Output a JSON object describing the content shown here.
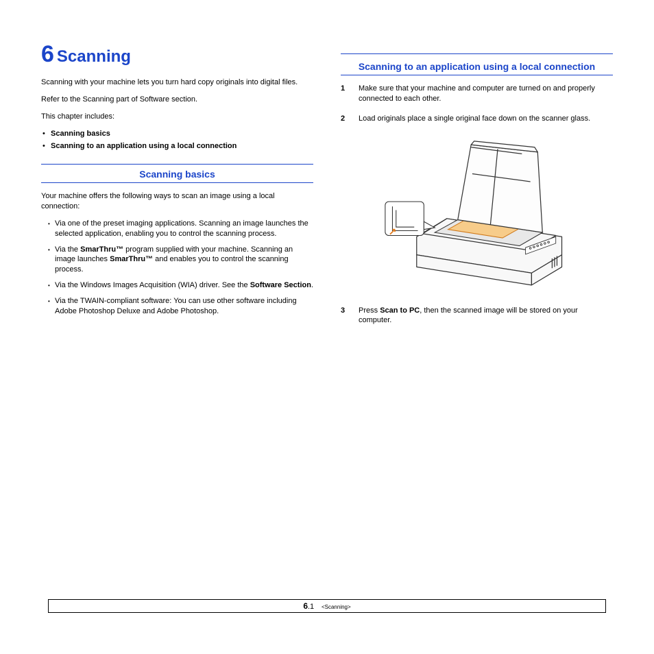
{
  "chapter": {
    "number": "6",
    "title": "Scanning"
  },
  "intro": {
    "p1": "Scanning with your machine lets you turn hard copy originals into digital files.",
    "p2": "Refer to the Scanning part of Software section.",
    "p3": "This chapter includes:"
  },
  "toc": {
    "i1": "Scanning basics",
    "i2": "Scanning to an application using a local connection"
  },
  "basics": {
    "heading": "Scanning basics",
    "lead": "Your machine offers the following ways to scan an image using a local connection:",
    "b1": "Via one of the preset imaging applications. Scanning an image launches the selected application, enabling you to control the scanning process.",
    "b2a": "Via the ",
    "b2b": "SmarThru™",
    "b2c": " program supplied with your machine. Scanning an image launches ",
    "b2d": "SmarThru™",
    "b2e": " and enables you to control the scanning process.",
    "b3a": "Via the Windows Images Acquisition (WIA) driver. See the ",
    "b3b": "Software Section",
    "b3c": ".",
    "b4": "Via the TWAIN-compliant software: You can use other software including Adobe Photoshop Deluxe and Adobe Photoshop."
  },
  "local": {
    "heading": "Scanning to an application using a local connection",
    "s1": "Make sure that your machine and computer are turned on and properly connected to each other.",
    "s2": "Load originals place a single original face down on the scanner glass.",
    "s3a": "Press ",
    "s3b": "Scan to PC",
    "s3c": ", then the scanned image will be stored on your computer."
  },
  "footer": {
    "big": "6",
    "sub": ".1",
    "label": "<Scanning>"
  }
}
